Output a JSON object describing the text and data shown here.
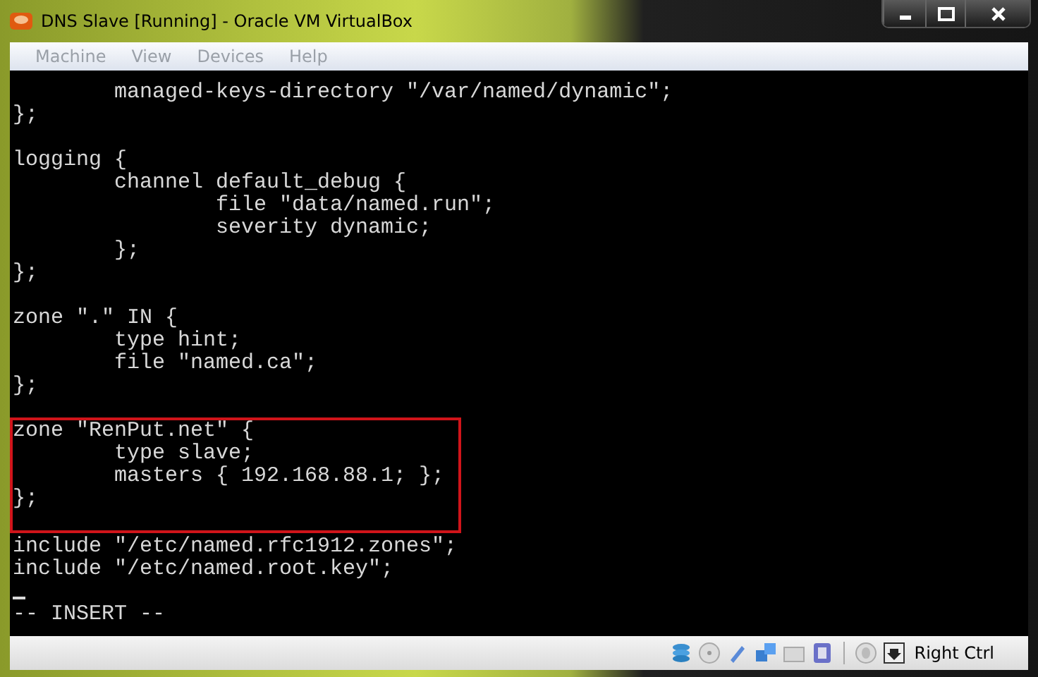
{
  "window": {
    "title": "DNS Slave [Running] - Oracle VM VirtualBox"
  },
  "menu": [
    {
      "label": "Machine",
      "disabled": true
    },
    {
      "label": "View",
      "disabled": true
    },
    {
      "label": "Devices",
      "disabled": true
    },
    {
      "label": "Help",
      "disabled": true
    }
  ],
  "terminal": {
    "lines": [
      {
        "text": "        managed-keys-directory \"/var/named/dynamic\";",
        "highlighted": false
      },
      {
        "text": "};",
        "highlighted": false
      },
      {
        "highlighted": false
      },
      {
        "text": "logging {",
        "highlighted": false
      },
      {
        "text": "        channel default_debug {",
        "highlighted": false
      },
      {
        "text": "                file \"data/named.run\";",
        "highlighted": false
      },
      {
        "text": "                severity dynamic;",
        "highlighted": false
      },
      {
        "text": "        };",
        "highlighted": false
      },
      {
        "text": "};",
        "highlighted": false
      },
      {
        "highlighted": false
      },
      {
        "text": "zone \".\" IN {",
        "highlighted": false
      },
      {
        "text": "        type hint;",
        "highlighted": false
      },
      {
        "text": "        file \"named.ca\";",
        "highlighted": false
      },
      {
        "text": "};",
        "highlighted": false
      },
      {
        "highlighted": false
      },
      {
        "text": "zone \"RenPut.net\" {",
        "highlighted": true
      },
      {
        "text": "        type slave;",
        "highlighted": true
      },
      {
        "text": "        masters { 192.168.88.1; };",
        "highlighted": true
      },
      {
        "text": "};",
        "highlighted": true
      },
      {
        "highlighted": false
      },
      {
        "text": "include \"/etc/named.rfc1912.zones\";",
        "highlighted": false
      },
      {
        "text": "include \"/etc/named.root.key\";",
        "highlighted": false
      },
      {
        "highlighted": false,
        "cursor": true
      },
      {
        "text": "-- INSERT --",
        "highlighted": false
      }
    ]
  },
  "status_bar": {
    "host_key": "Right Ctrl"
  }
}
